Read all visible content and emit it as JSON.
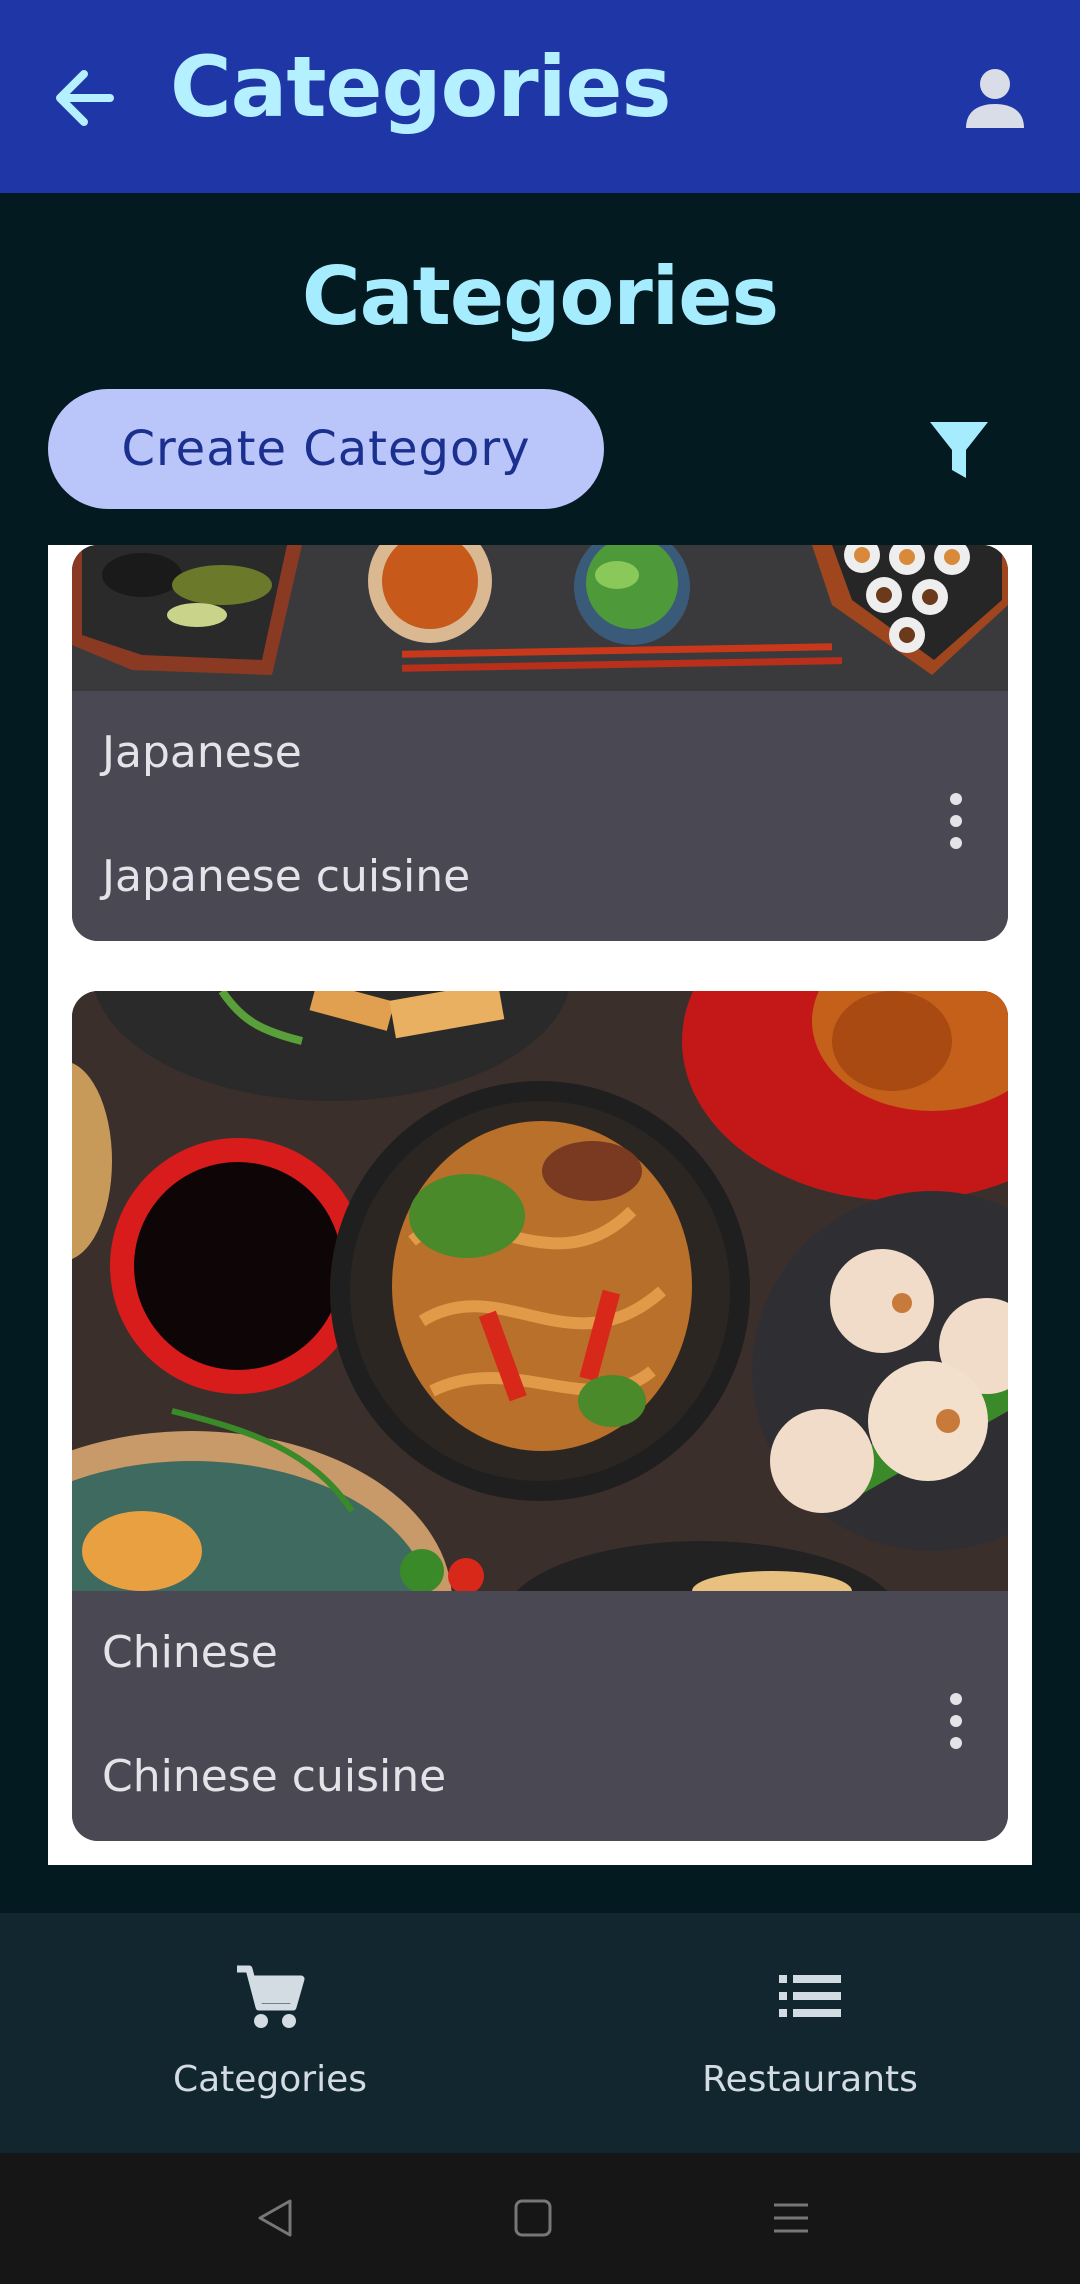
{
  "app_bar": {
    "title": "Categories",
    "back_icon": "arrow-back-icon",
    "profile_icon": "person-icon",
    "background": "#1f36a6",
    "title_color": "#b4f0ff"
  },
  "main": {
    "heading": "Categories",
    "create_button_label": "Create Category",
    "filter_icon": "filter-icon"
  },
  "categories": [
    {
      "name": "Japanese",
      "description": "Japanese cuisine",
      "image": "japanese-food-photo"
    },
    {
      "name": "Chinese",
      "description": "Chinese cuisine",
      "image": "chinese-food-photo"
    }
  ],
  "bottom_nav": {
    "items": [
      {
        "label": "Categories",
        "icon": "shopping-cart-icon"
      },
      {
        "label": "Restaurants",
        "icon": "list-icon"
      }
    ]
  },
  "system_nav": {
    "back": "back-triangle-icon",
    "home": "home-square-icon",
    "menu": "menu-lines-icon"
  }
}
